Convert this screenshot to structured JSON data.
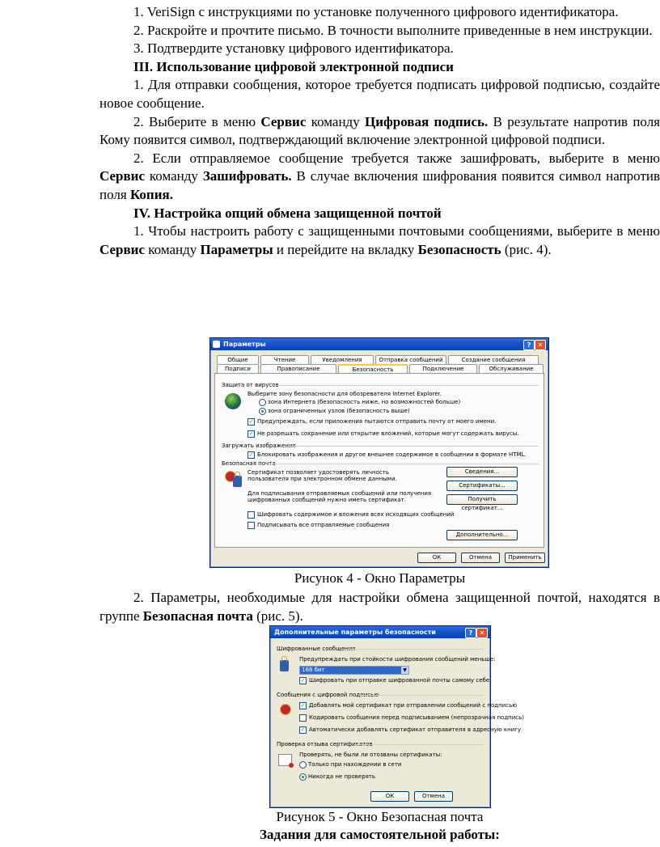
{
  "doc": {
    "p1": "1. VeriSign с инструкциями по установке полученного цифрового идентификатора.",
    "p2": "2. Раскройте и прочтите письмо. В точности выполните приведенные в нем инструкции.",
    "p3": "3. Подтвердите установку цифрового идентификатора.",
    "h3": "III. Использование цифровой электронной подписи",
    "p4": "1. Для отправки сообщения, которое требуется подписать цифровой подписью, создайте новое сообщение.",
    "p5_a": "2. Выберите в меню ",
    "p5_b": "Сервис",
    "p5_c": " команду ",
    "p5_d": "Цифровая подпись.",
    "p5_e": " В результате напротив поля Кому появится символ, подтверждающий включение электронной цифровой подписи.",
    "p6_a": "2. Если отправляемое сообщение требуется также зашифровать, выберите в меню ",
    "p6_b": "Сервис",
    "p6_c": " команду ",
    "p6_d": "Зашифровать.",
    "p6_e": " В случае включения шифрования появится символ напротив поля ",
    "p6_f": "Копия.",
    "h4": "IV. Настройка опций обмена защищенной почтой",
    "p7_a": "1. Чтобы настроить работу с защищенными почтовыми сообщениями, выберите в меню ",
    "p7_b": "Сервис",
    "p7_c": " команду ",
    "p7_d": "Параметры",
    "p7_e": " и перейдите на вкладку ",
    "p7_f": "Безопасность",
    "p7_g": " (рис. 4).",
    "cap4": "Рисунок 4 - Окно Параметры",
    "p8_a": "2. Параметры, необходимые для настройки обмена защищенной почтой, находятся в группе ",
    "p8_b": "Безопасная почта",
    "p8_c": " (рис. 5).",
    "cap5": "Рисунок 5 - Окно Безопасная почта",
    "h5": "Задания для самостоятельной работы:"
  },
  "win1": {
    "title": "Параметры",
    "tabs_row1": [
      "Общие",
      "Чтение",
      "Уведомления",
      "Отправка сообщений",
      "Создание сообщения"
    ],
    "tabs_row2": [
      "Подписи",
      "Правописание",
      "Безопасность",
      "Подключение",
      "Обслуживание"
    ],
    "g1": "Защита от вирусов",
    "g1_t": "Выберите зону безопасности для обозревателя Internet Explorer.",
    "r1": "зона Интернета (безопасность ниже, но возможностей больше)",
    "r2": "зона ограниченных узлов (безопасность выше)",
    "c1": "Предупреждать, если приложения пытаются отправить почту от моего имени.",
    "c2": "Не разрешать сохранение или открытие вложений, которые могут содержать вирусы.",
    "g2": "Загружать изображения",
    "c3": "Блокировать изображения и другое внешнее содержимое в сообщении в формате HTML.",
    "g3": "Безопасная почта",
    "t1a": "Сертификат позволяет удостоверять личность",
    "t1b": "пользователя при электронном обмене данными.",
    "b1": "Сведения...",
    "b2": "Сертификаты...",
    "t2a": "Для подписывания отправляемых сообщений или получения",
    "t2b": "шифрованных сообщений нужно иметь сертификат.",
    "b3": "Получить сертификат...",
    "c4": "Шифровать содержимое и вложения всех исходящих сообщений",
    "c5": "Подписывать все отправляемые сообщения",
    "b4": "Дополнительно...",
    "ok": "ОК",
    "cancel": "Отмена",
    "apply": "Применить"
  },
  "win2": {
    "title": "Дополнительные параметры безопасности",
    "g1": "Шифрованные сообщения",
    "t1": "Предупреждать при стойкости шифрования сообщений меньше:",
    "sel": "168 бит",
    "c1": "Шифровать при отправке шифрованной почты самому себе",
    "g2": "Сообщения с цифровой подписью",
    "c2": "Добавлять мой сертификат при отправлении сообщений с подписью",
    "c3": "Кодировать сообщения перед подписыванием (непрозрачная подпись)",
    "c4": "Автоматически добавлять сертификат отправителя в адресную книгу",
    "g3": "Проверка отзыва сертификатов",
    "t2": "Проверять, не были ли отозваны сертификаты:",
    "r1": "Только при нахождении в сети",
    "r2": "Никогда не проверять",
    "ok": "ОК",
    "cancel": "Отмена"
  }
}
